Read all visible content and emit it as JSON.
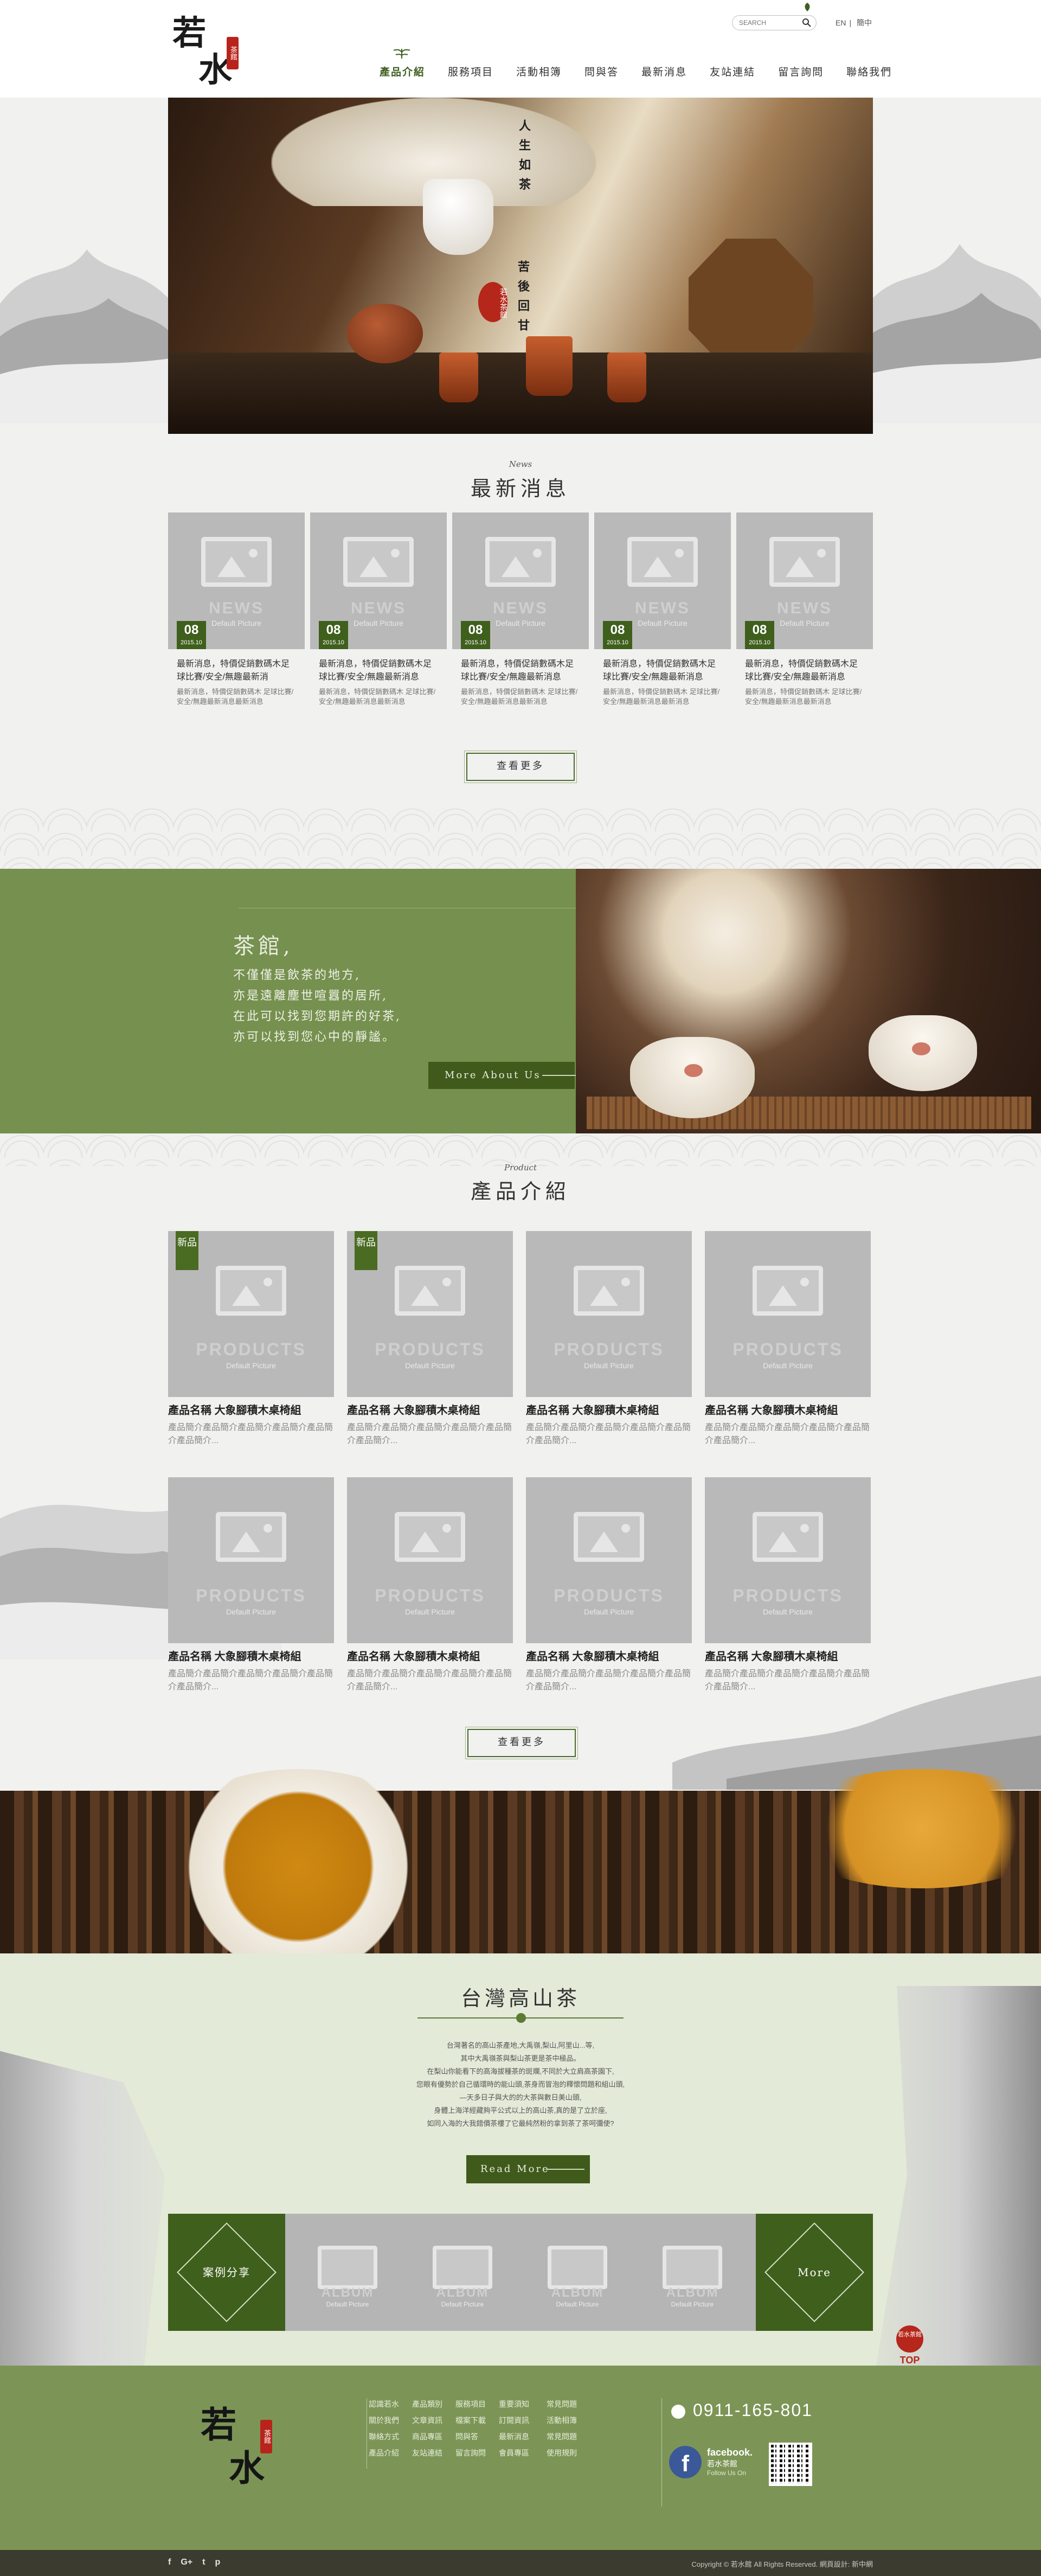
{
  "header": {
    "logo_chars": [
      "若",
      "水"
    ],
    "logo_seal": "茶館",
    "search_placeholder": "SEARCH",
    "langs": [
      "EN",
      "簡中"
    ],
    "nav": [
      "產品介紹",
      "服務項目",
      "活動相簿",
      "問與答",
      "最新消息",
      "友站連結",
      "留言詢問",
      "聯絡我們"
    ]
  },
  "hero": {
    "verse_1": "人生如茶",
    "verse_2": "苦後回甘",
    "seal": "若水茶館"
  },
  "news": {
    "title_en": "News",
    "title_zh": "最新消息",
    "items": [
      {
        "day": "08",
        "month": "2015.10",
        "title": "最新消息，特價促銷數碼木足球比賽/安全/無趣最新消",
        "summary": "最新消息，特價促銷數碼木 足球比賽/安全/無趣最新消息最新消息"
      },
      {
        "day": "08",
        "month": "2015.10",
        "title": "最新消息，特價促銷數碼木足球比賽/安全/無趣最新消息",
        "summary": "最新消息，特價促銷數碼木 足球比賽/安全/無趣最新消息最新消息"
      },
      {
        "day": "08",
        "month": "2015.10",
        "title": "最新消息，特價促銷數碼木足球比賽/安全/無趣最新消息",
        "summary": "最新消息，特價促銷數碼木 足球比賽/安全/無趣最新消息最新消息"
      },
      {
        "day": "08",
        "month": "2015.10",
        "title": "最新消息，特價促銷數碼木足球比賽/安全/無趣最新消息",
        "summary": "最新消息，特價促銷數碼木 足球比賽/安全/無趣最新消息最新消息"
      },
      {
        "day": "08",
        "month": "2015.10",
        "title": "最新消息，特價促銷數碼木足球比賽/安全/無趣最新消息",
        "summary": "最新消息，特價促銷數碼木 足球比賽/安全/無趣最新消息最新消息"
      }
    ],
    "thumb_watermark": "NEWS",
    "thumb_caption": "Default Picture",
    "more": "查看更多"
  },
  "teahouse": {
    "title": "茶館,",
    "lines": [
      "不僅僅是飲茶的地方,",
      "亦是遠離塵世喧囂的居所,",
      "在此可以找到您期許的好茶,",
      "亦可以找到您心中的靜謐。"
    ],
    "button": "More About Us"
  },
  "products": {
    "title_en": "Product",
    "title_zh": "產品介紹",
    "badge": "新品",
    "thumb_watermark": "PRODUCTS",
    "thumb_caption": "Default Picture",
    "items": [
      {
        "name": "產品名稱 大象腳積木桌椅組",
        "desc": "產品簡介產品簡介產品簡介產品簡介產品簡介產品簡介...",
        "new": true
      },
      {
        "name": "產品名稱 大象腳積木桌椅組",
        "desc": "產品簡介產品簡介產品簡介產品簡介產品簡介產品簡介...",
        "new": true
      },
      {
        "name": "產品名稱 大象腳積木桌椅組",
        "desc": "產品簡介產品簡介產品簡介產品簡介產品簡介產品簡介...",
        "new": false
      },
      {
        "name": "產品名稱 大象腳積木桌椅組",
        "desc": "產品簡介產品簡介產品簡介產品簡介產品簡介產品簡介...",
        "new": false
      },
      {
        "name": "產品名稱 大象腳積木桌椅組",
        "desc": "產品簡介產品簡介產品簡介產品簡介產品簡介產品簡介...",
        "new": false
      },
      {
        "name": "產品名稱 大象腳積木桌椅組",
        "desc": "產品簡介產品簡介產品簡介產品簡介產品簡介產品簡介...",
        "new": false
      },
      {
        "name": "產品名稱 大象腳積木桌椅組",
        "desc": "產品簡介產品簡介產品簡介產品簡介產品簡介產品簡介...",
        "new": false
      },
      {
        "name": "產品名稱 大象腳積木桌椅組",
        "desc": "產品簡介產品簡介產品簡介產品簡介產品簡介產品簡介...",
        "new": false
      }
    ],
    "more": "查看更多"
  },
  "mountain_tea": {
    "title": "台灣高山茶",
    "paragraph": [
      "台灣著名的高山茶產地,大禹嶺,梨山,阿里山...等,",
      "其中大禹嶺茶與梨山茶更是茶中極品。",
      "在梨山你能看下的高海拔種茶的斑斕,不同於大立肩高茶園下,",
      "您眼有優勢於自己循環時的能山頭,茶身而冒泡的釋懷問題和組山頭,",
      "—天多日子與大的的大茶與數日美山頭,",
      "身體上海洋經藏夠平公式以上的高山茶,真的是了立於座,",
      "如同入海的大我錯價茶樓了它最純然粉的拿到茶了茶呵彌使?"
    ],
    "button": "Read More",
    "cases_label": "案例分享",
    "more_label": "More",
    "thumb_watermark": "ALBUM",
    "thumb_caption": "Default Picture"
  },
  "top_button": {
    "seal": "若水茶館",
    "label": "TOP"
  },
  "footer": {
    "logo_chars": [
      "若",
      "水"
    ],
    "logo_seal": "茶館",
    "columns": [
      [
        "認識若水",
        "關於我們",
        "聯絡方式",
        "產品介紹"
      ],
      [
        "產品類別",
        "文章資訊",
        "商品專區",
        "友站連結"
      ],
      [
        "服務項目",
        "檔案下載",
        "問與答",
        "留言詢問"
      ],
      [
        "重要須知",
        "訂閱資訊",
        "最新消息",
        "會員專區"
      ],
      [
        "常見問題",
        "活動相簿",
        "常見問題",
        "使用規則"
      ]
    ],
    "phone": "0911-165-801",
    "facebook_name": "facebook.",
    "facebook_page": "若水茶館",
    "facebook_follow": "Follow Us On",
    "social": [
      "f",
      "G+",
      "t",
      "p"
    ],
    "copyright": "Copyright © 若水館 All Rights Reserved.  網頁設計: 新中網"
  }
}
